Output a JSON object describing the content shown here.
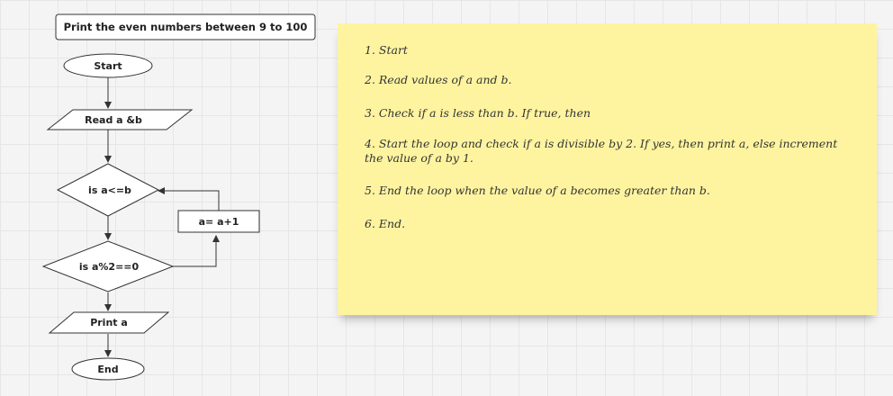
{
  "flowchart": {
    "title": "Print the even numbers between 9 to 100",
    "start": "Start",
    "read": "Read a &b",
    "condition_lt": "is a<=b",
    "condition_even": "is a%2==0",
    "increment": "a= a+1",
    "print": "Print a",
    "end": "End"
  },
  "sticky_note": {
    "steps": [
      "1. Start",
      "2. Read values of a and b.",
      "3. Check if a is less than b. If true, then",
      "4. Start the loop and check if a is divisible by 2. If yes, then print a, else increment the value of a by 1.",
      "5. End the loop when the value of a becomes greater than b.",
      "6. End."
    ]
  },
  "colors": {
    "sticky_background": "#fef4a0",
    "canvas_background": "#f4f4f4",
    "stroke": "#333333",
    "grid": "#e6e6e6"
  }
}
